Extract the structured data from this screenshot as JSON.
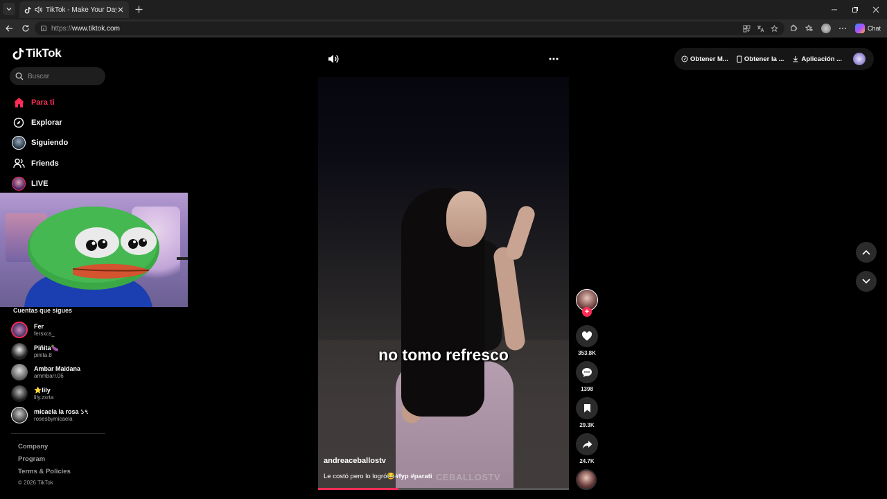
{
  "browser": {
    "tab_title": "TikTok - Make Your Day",
    "url_protocol": "https://",
    "url_host": "www.tiktok.com",
    "chat_label": "Chat"
  },
  "sidebar": {
    "logo_text": "TikTok",
    "search_placeholder": "Buscar",
    "nav": [
      {
        "label": "Para ti",
        "icon": "home-icon"
      },
      {
        "label": "Explorar",
        "icon": "compass-icon"
      },
      {
        "label": "Siguiendo",
        "icon": "following-avatar-icon"
      },
      {
        "label": "Friends",
        "icon": "friends-icon"
      },
      {
        "label": "LIVE",
        "icon": "live-icon"
      }
    ],
    "following_title": "Cuentas que sigues",
    "following": [
      {
        "name": "Fer",
        "handle": "fersxcs_"
      },
      {
        "name": "Piñita🍆",
        "handle": "pinita.8"
      },
      {
        "name": "Ambar Maidana",
        "handle": "ammbarr.06"
      },
      {
        "name": "⭐lily",
        "handle": "lily.zxrta"
      },
      {
        "name": "micaela la rosa ১৭",
        "handle": "rosesbymicaela"
      }
    ],
    "footer_links": [
      "Company",
      "Program",
      "Terms & Policies"
    ],
    "copyright": "© 2026 TikTok"
  },
  "top_actions": {
    "item1": "Obtener M...",
    "item2": "Obtener la ...",
    "item3": "Aplicación ..."
  },
  "video": {
    "caption": "no tomo refresco",
    "username": "andreaceballostv",
    "description": "Le costó pero lo logró😂",
    "hashtags": "#fyp #parati",
    "watermark": "CEBALLOSTV",
    "progress": 0.32
  },
  "actions": {
    "likes": "353.8K",
    "comments": "1398",
    "saves": "29.3K",
    "shares": "24.7K"
  },
  "colors": {
    "accent": "#fe2c55",
    "background": "#000000"
  }
}
